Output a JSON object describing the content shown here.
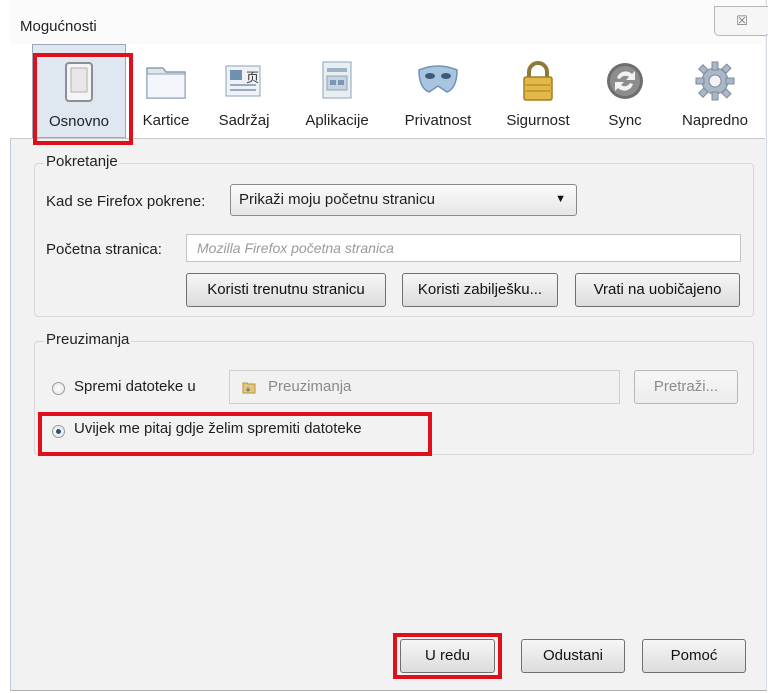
{
  "window": {
    "title": "Mogućnosti",
    "close_label": "☒"
  },
  "toolbar": {
    "tabs": [
      {
        "label": "Osnovno",
        "icon": "switch-icon"
      },
      {
        "label": "Kartice",
        "icon": "tabs-icon"
      },
      {
        "label": "Sadržaj",
        "icon": "content-icon"
      },
      {
        "label": "Aplikacije",
        "icon": "applications-icon"
      },
      {
        "label": "Privatnost",
        "icon": "mask-icon"
      },
      {
        "label": "Sigurnost",
        "icon": "lock-icon"
      },
      {
        "label": "Sync",
        "icon": "sync-icon"
      },
      {
        "label": "Napredno",
        "icon": "gear-icon"
      }
    ]
  },
  "startup": {
    "group_title": "Pokretanje",
    "when_starts_label": "Kad se Firefox pokrene:",
    "when_starts_value": "Prikaži moju početnu stranicu",
    "homepage_label": "Početna stranica:",
    "homepage_placeholder": "Mozilla Firefox početna stranica",
    "btn_current": "Koristi trenutnu stranicu",
    "btn_bookmark": "Koristi zabilješku...",
    "btn_default": "Vrati na uobičajeno"
  },
  "downloads": {
    "group_title": "Preuzimanja",
    "save_files_label": "Spremi datoteke u",
    "folder_value": "Preuzimanja",
    "browse_label": "Pretraži...",
    "always_ask_label": "Uvijek me pitaj gdje želim spremiti datoteke",
    "save_files_selected": false,
    "always_ask_selected": true
  },
  "footer": {
    "ok": "U redu",
    "cancel": "Odustani",
    "help": "Pomoć"
  },
  "colors": {
    "highlight": "#e00f1c",
    "active_tab": "#dfe7f0"
  }
}
